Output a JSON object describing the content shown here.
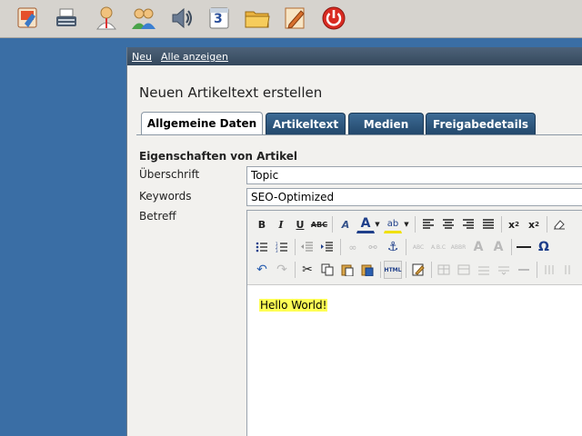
{
  "taskbar": {
    "icons": [
      "home-icon",
      "typewriter-icon",
      "user-icon",
      "users-icon",
      "speaker-icon",
      "calendar-icon",
      "folder-icon",
      "edit-document-icon",
      "power-icon"
    ],
    "calendar_day": "3"
  },
  "window": {
    "menu": {
      "new_label": "Neu",
      "show_all_label": "Alle anzeigen"
    },
    "title": "Neuen Artikeltext erstellen",
    "tabs": [
      {
        "label": "Allgemeine Daten"
      },
      {
        "label": "Artikeltext"
      },
      {
        "label": "Medien"
      },
      {
        "label": "Freigabedetails"
      }
    ],
    "section_title": "Eigenschaften von Artikel",
    "fields": {
      "heading": {
        "label": "Überschrift",
        "value": "Topic"
      },
      "keywords": {
        "label": "Keywords",
        "value": "SEO-Optimized"
      },
      "subject": {
        "label": "Betreff"
      }
    },
    "editor": {
      "content": "Hello World!",
      "highlight_color": "#ffff55"
    }
  },
  "colors": {
    "desktop": "#3a6ea5",
    "tab_active_bg": "#ffffff",
    "tab_inactive_bg": "#2c5479",
    "menubar_bg": "#3d5268"
  }
}
